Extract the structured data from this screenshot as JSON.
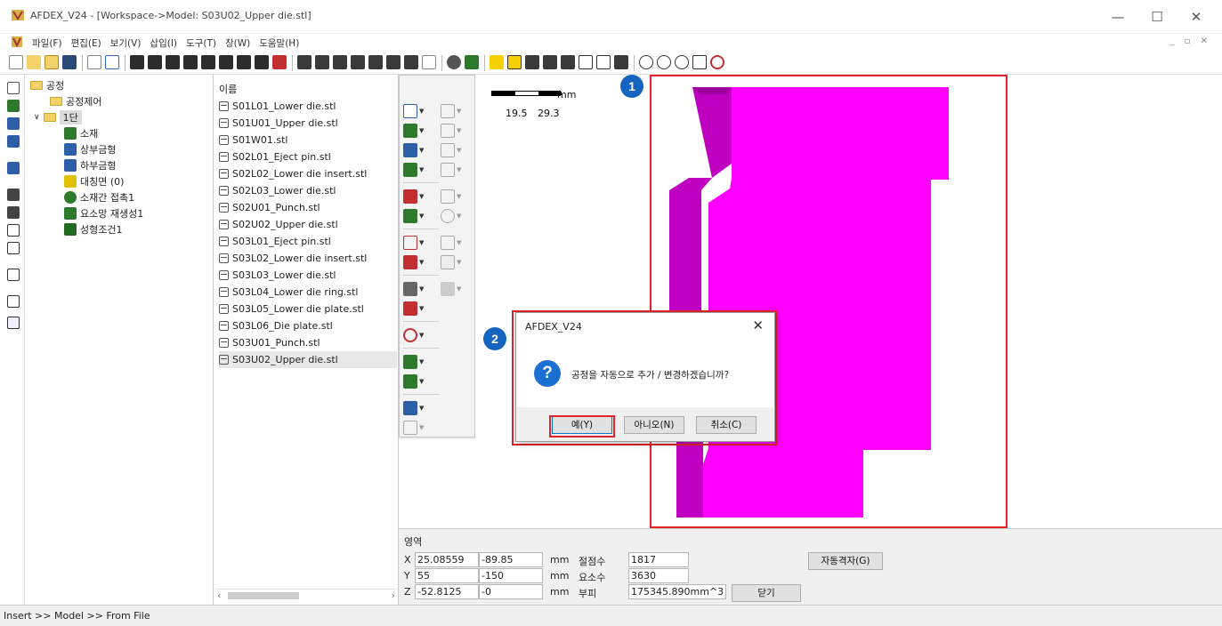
{
  "window": {
    "title": "AFDEX_V24 - [Workspace->Model: S03U02_Upper die.stl]",
    "controls": [
      "—",
      "☐",
      "✕"
    ]
  },
  "menu": {
    "items": [
      "파일(F)",
      "편집(E)",
      "보기(V)",
      "삽입(I)",
      "도구(T)",
      "창(W)",
      "도움말(H)"
    ],
    "mdi_controls": "_ ▫ ✕"
  },
  "tree": {
    "root": "공정",
    "process_control": "공정제어",
    "stage": "1단",
    "children": [
      "소재",
      "상부금형",
      "하부금형",
      "대칭면 (0)",
      "소재간 접촉1",
      "요소망 재생성1",
      "성형조건1"
    ]
  },
  "file_list": {
    "header": "이름",
    "files": [
      "S01L01_Lower die.stl",
      "S01U01_Upper die.stl",
      "S01W01.stl",
      "S02L01_Eject pin.stl",
      "S02L02_Lower die insert.stl",
      "S02L03_Lower die.stl",
      "S02U01_Punch.stl",
      "S02U02_Upper die.stl",
      "S03L01_Eject pin.stl",
      "S03L02_Lower die insert.stl",
      "S03L03_Lower die.stl",
      "S03L04_Lower die ring.stl",
      "S03L05_Lower die plate.stl",
      "S03L06_Die plate.stl",
      "S03U01_Punch.stl",
      "S03U02_Upper die.stl"
    ],
    "selected": "S03U02_Upper die.stl"
  },
  "viewport": {
    "scale_unit": "mm",
    "scale_ticks": [
      "19.5",
      "29.3"
    ],
    "model_color": "#ff00ff",
    "model_shade": "#c000c0",
    "highlight_color": "#e2232a",
    "badge_1": "1",
    "badge_2": "2"
  },
  "dialog": {
    "title": "AFDEX_V24",
    "close": "✕",
    "icon": "?",
    "message": "공정을 자동으로 추가 / 변경하겠습니까?",
    "yes": "예(Y)",
    "no": "아니오(N)",
    "cancel": "취소(C)"
  },
  "info": {
    "section": "영역",
    "x_label": "X",
    "x_min": "25.08559",
    "x_max": "-89.85",
    "y_label": "Y",
    "y_min": "55",
    "y_max": "-150",
    "z_label": "Z",
    "z_min": "-52.8125",
    "z_max": "-0",
    "dash": "-",
    "unit": "mm",
    "nodes_label": "절점수",
    "nodes_value": "1817",
    "elements_label": "요소수",
    "elements_value": "3630",
    "volume_label": "부피",
    "volume_value": "175345.890mm^3",
    "auto_mesh_button": "자동격자(G)",
    "close_button": "닫기"
  },
  "status": {
    "text": "Insert >> Model >> From File"
  }
}
